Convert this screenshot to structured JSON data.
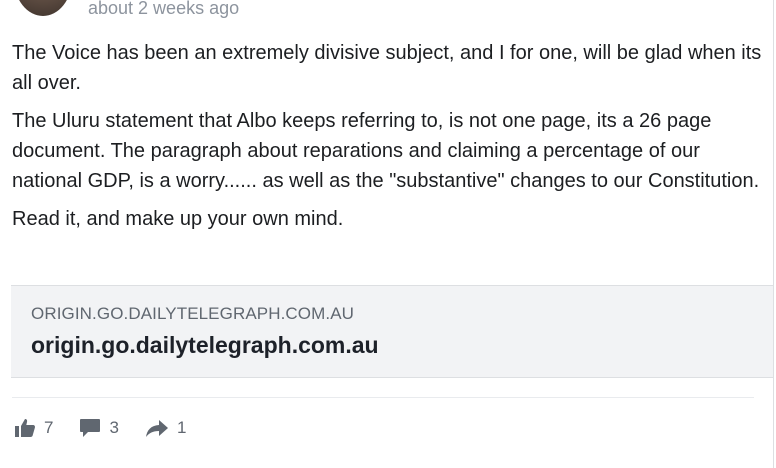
{
  "post": {
    "timestamp": "about 2 weeks ago",
    "paragraphs": [
      "The Voice has been an extremely divisive subject, and I for one, will be glad when its all over.",
      "The Uluru statement that Albo keeps referring to, is not one page, its a 26 page document. The paragraph about reparations and claiming a percentage of our national GDP, is a worry...... as well as the \"substantive\" changes to our Constitution.",
      "Read it, and make up your own mind."
    ]
  },
  "link_preview": {
    "domain": "ORIGIN.GO.DAILYTELEGRAPH.COM.AU",
    "title": "origin.go.dailytelegraph.com.au"
  },
  "actions": {
    "like": {
      "icon": "thumbs-up-icon",
      "count": "7"
    },
    "comment": {
      "icon": "comment-bubble-icon",
      "count": "3"
    },
    "share": {
      "icon": "share-arrow-icon",
      "count": "1"
    }
  },
  "colors": {
    "text": "#1c1e21",
    "muted": "#8d949e",
    "icon": "#606770",
    "card_bg": "#f2f3f5"
  }
}
